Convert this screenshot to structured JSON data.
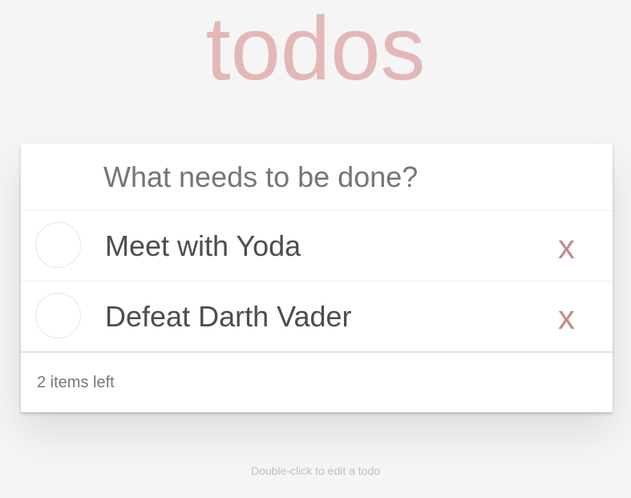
{
  "header": {
    "title": "todos"
  },
  "new_todo": {
    "placeholder": "What needs to be done?",
    "value": ""
  },
  "todos": [
    {
      "label": "Meet with Yoda",
      "completed": false,
      "destroy_label": "x"
    },
    {
      "label": "Defeat Darth Vader",
      "completed": false,
      "destroy_label": "x"
    }
  ],
  "footer": {
    "count_text": "2 items left"
  },
  "info": {
    "hint": "Double-click to edit a todo"
  },
  "colors": {
    "title": "#e3b7b8",
    "destroy": "#c18c8c",
    "background": "#f5f5f5"
  }
}
